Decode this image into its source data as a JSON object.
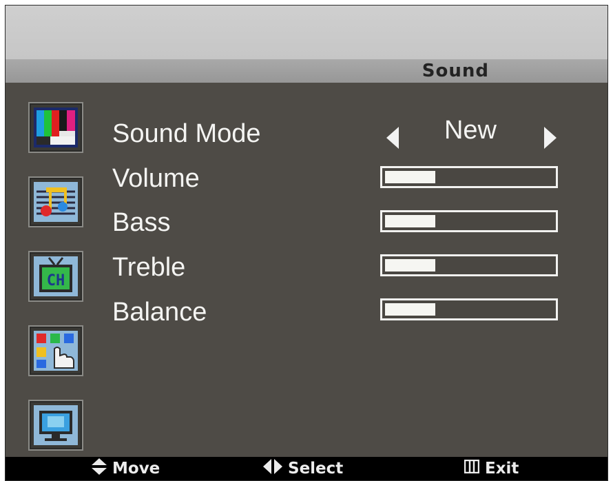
{
  "menu": {
    "title": "Sound",
    "sound_mode": {
      "label": "Sound Mode",
      "value": "New"
    },
    "sliders": [
      {
        "label": "Volume",
        "level_percent": 30
      },
      {
        "label": "Bass",
        "level_percent": 30
      },
      {
        "label": "Treble",
        "level_percent": 30
      },
      {
        "label": "Balance",
        "level_percent": 30
      }
    ]
  },
  "sidebar": {
    "icons": [
      "picture-icon",
      "sound-icon",
      "channel-icon",
      "function-icon",
      "screen-icon"
    ],
    "channel_icon_text": "CH"
  },
  "footer": {
    "move": "Move",
    "select": "Select",
    "exit": "Exit"
  },
  "colors": {
    "panel": "#4e4b46",
    "title_bar": "#a0a0a0",
    "text": "#f4f4f2",
    "footer": "#000000"
  }
}
